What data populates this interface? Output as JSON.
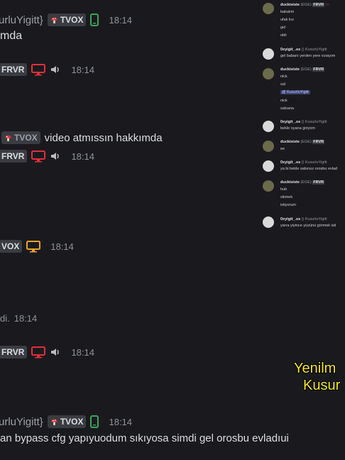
{
  "messages": [
    {
      "name_partial": "urluYigitt}",
      "badge": "TVOX",
      "time": "18:14",
      "text": "mda"
    },
    {
      "badge": "FRVR",
      "time": "18:14"
    },
    {
      "badge": "TVOX",
      "text": "video atmıssın hakkımda",
      "time": ""
    },
    {
      "badge": "FRVR",
      "time": "18:14"
    },
    {
      "badge": "VOX",
      "time": "18:14"
    },
    {
      "text": "di.",
      "time": "18:14"
    },
    {
      "badge": "FRVR",
      "time": "18:14"
    },
    {
      "name_partial": "urluYigitt}",
      "badge": "TVOX",
      "time": "18:14",
      "text": "an bypass cfg yapıyuodum sıkıyosa simdi gel orosbu evladıui"
    }
  ],
  "overlay": {
    "items": [
      {
        "name": "duckisiste",
        "tag": "(EGE)",
        "badge": "FRVR",
        "lines": [
          "bakalım",
          "ufak kız",
          "gel",
          "obli"
        ]
      },
      {
        "name": "0xyigit_.ss",
        "tag": "() KusurluYigitt",
        "lines": [
          "gel babanı yerden yere vurayım"
        ]
      },
      {
        "name": "duckisiste",
        "tag": "(EGE)",
        "badge": "FRVR",
        "lines": [
          "nick",
          "sal",
          "@ KusurluYigitt",
          "nick",
          "salsana"
        ]
      },
      {
        "name": "0xyigit_.ss",
        "tag": "() KusurluYigitt",
        "lines": [
          "bekle oyana giriyom"
        ]
      },
      {
        "name": "duckisiste",
        "tag": "(EGE)",
        "badge": "FRVR",
        "lines": [
          "ee"
        ]
      },
      {
        "name": "0xyigit_.ss",
        "tag": "() KusurluYigitt",
        "lines": [
          "ya bi bekle sabırsız orosbu evlad"
        ]
      },
      {
        "name": "duckisiste",
        "tag": "(EGE)",
        "badge": "FRVR",
        "lines": [
          "hub",
          "sikmek",
          "istiyorum"
        ]
      },
      {
        "name": "0xyigit_.ss",
        "tag": "() KusurluYigitt",
        "lines": [
          "yarra yiyince yüzünü görmek isti"
        ]
      }
    ]
  },
  "caption": {
    "line1": "Yenilm",
    "line2": "Kusur"
  },
  "colors": {
    "background": "#1a1a1e",
    "badge": "#3a3c42",
    "red_icon": "#e0303a",
    "green_icon": "#3ba55c",
    "yellow_icon": "#e8a42a",
    "caption": "#f5e629"
  }
}
